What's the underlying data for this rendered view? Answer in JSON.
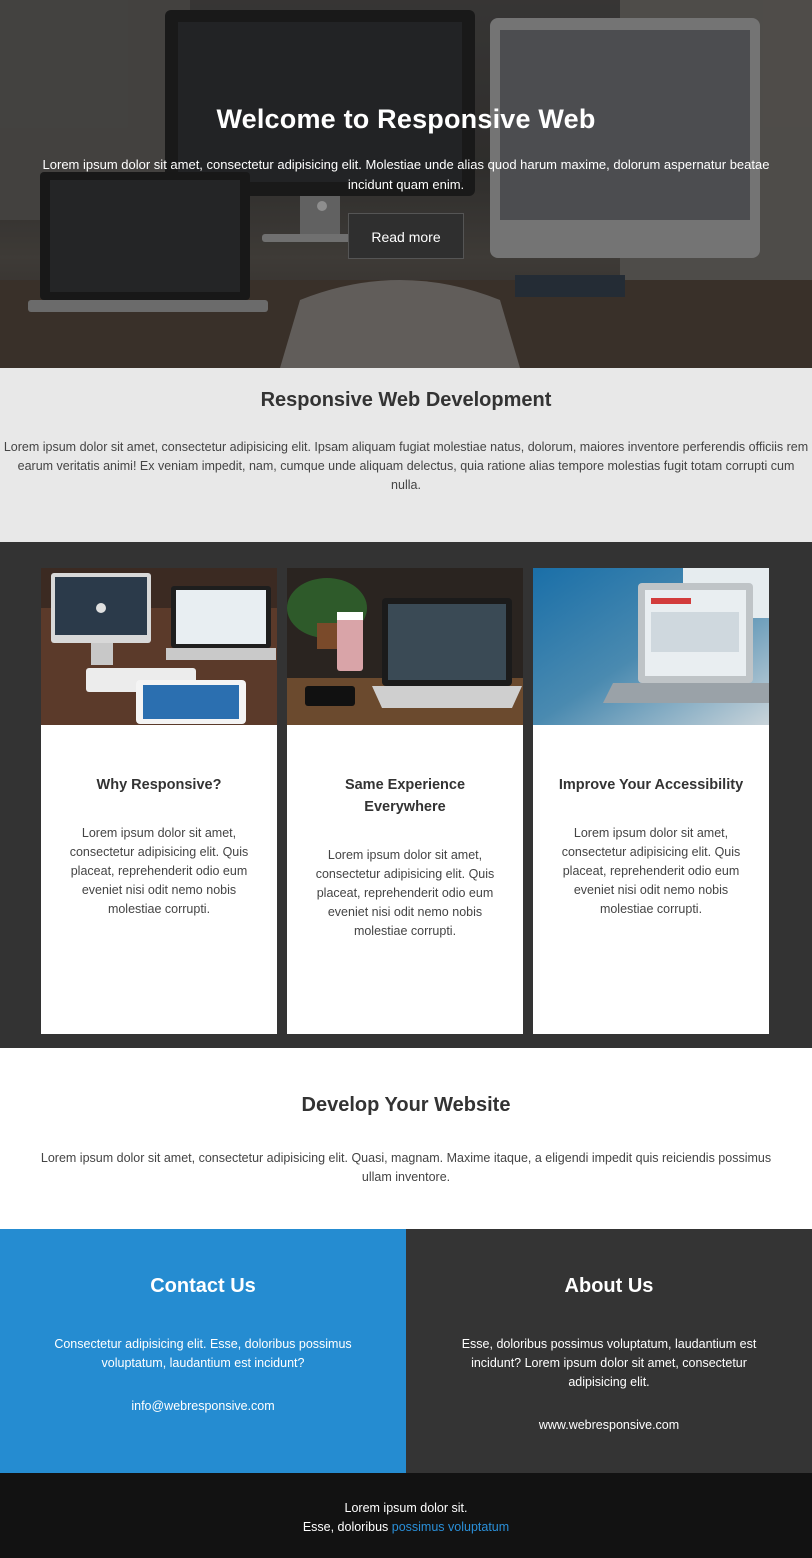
{
  "hero": {
    "title": "Welcome to Responsive Web",
    "text": "Lorem ipsum dolor sit amet, consectetur adipisicing elit. Molestiae unde alias quod harum maxime, dolorum aspernatur beatae incidunt quam enim.",
    "button_label": "Read more"
  },
  "intro": {
    "title": "Responsive Web Development",
    "text": "Lorem ipsum dolor sit amet, consectetur adipisicing elit. Ipsam aliquam fugiat molestiae natus, dolorum, maiores inventore perferendis officiis rem earum veritatis animi! Ex veniam impedit, nam, cumque unde aliquam delectus, quia ratione alias tempore molestias fugit totam corrupti cum nulla."
  },
  "cards": [
    {
      "title": "Why Responsive?",
      "text": "Lorem ipsum dolor sit amet, consectetur adipisicing elit. Quis placeat, reprehenderit odio eum eveniet nisi odit nemo nobis molestiae corrupti."
    },
    {
      "title": "Same Experience Everywhere",
      "text": "Lorem ipsum dolor sit amet, consectetur adipisicing elit. Quis placeat, reprehenderit odio eum eveniet nisi odit nemo nobis molestiae corrupti."
    },
    {
      "title": "Improve Your Accessibility",
      "text": "Lorem ipsum dolor sit amet, consectetur adipisicing elit. Quis placeat, reprehenderit odio eum eveniet nisi odit nemo nobis molestiae corrupti."
    }
  ],
  "develop": {
    "title": "Develop Your Website",
    "text": "Lorem ipsum dolor sit amet, consectetur adipisicing elit. Quasi, magnam. Maxime itaque, a eligendi impedit quis reiciendis possimus ullam inventore."
  },
  "contact": {
    "title": "Contact Us",
    "text": "Consectetur adipisicing elit. Esse, doloribus possimus voluptatum, laudantium est incidunt?",
    "email": "info@webresponsive.com"
  },
  "about": {
    "title": "About Us",
    "text": "Esse, doloribus possimus voluptatum, laudantium est incidunt? Lorem ipsum dolor sit amet, consectetur adipisicing elit.",
    "website": "www.webresponsive.com"
  },
  "footer": {
    "line1": "Lorem ipsum dolor sit.",
    "line2_prefix": "Esse, doloribus ",
    "line2_link": "possimus voluptatum"
  },
  "colors": {
    "accent": "#258cd1",
    "dark": "#333333",
    "footer": "#121212",
    "link": "#2a8fd8"
  },
  "icons": [
    "apple-logo-icon"
  ]
}
